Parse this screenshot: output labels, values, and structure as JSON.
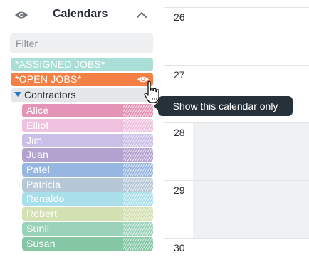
{
  "sidebar": {
    "title": "Calendars",
    "filter_placeholder": "Filter",
    "calendars": [
      {
        "label": "*ASSIGNED JOBS*",
        "color": "#a9dfd6"
      },
      {
        "label": "*OPEN JOBS*",
        "color": "#f58045",
        "eye_icon": "eye-icon"
      }
    ],
    "group": {
      "label": "Contractors",
      "expanded": true,
      "members": [
        {
          "label": "Alice",
          "color": "#e495b7"
        },
        {
          "label": "Elliot",
          "color": "#efc1de"
        },
        {
          "label": "Jim",
          "color": "#c9bfe7"
        },
        {
          "label": "Juan",
          "color": "#b3a2d0"
        },
        {
          "label": "Patel",
          "color": "#97b6e2"
        },
        {
          "label": "Patricia",
          "color": "#b6c7d8"
        },
        {
          "label": "Renaldo",
          "color": "#a9dfea"
        },
        {
          "label": "Robert",
          "color": "#d3e0b1"
        },
        {
          "label": "Sunil",
          "color": "#9ad2ba"
        },
        {
          "label": "Susan",
          "color": "#85c7a5"
        }
      ]
    }
  },
  "tooltip": {
    "text": "Show this calendar only"
  },
  "calendar": {
    "days": [
      "26",
      "27",
      "28",
      "29",
      "30"
    ]
  },
  "colors": {
    "accent": "#2677c7",
    "tooltip_bg": "#26313a"
  }
}
